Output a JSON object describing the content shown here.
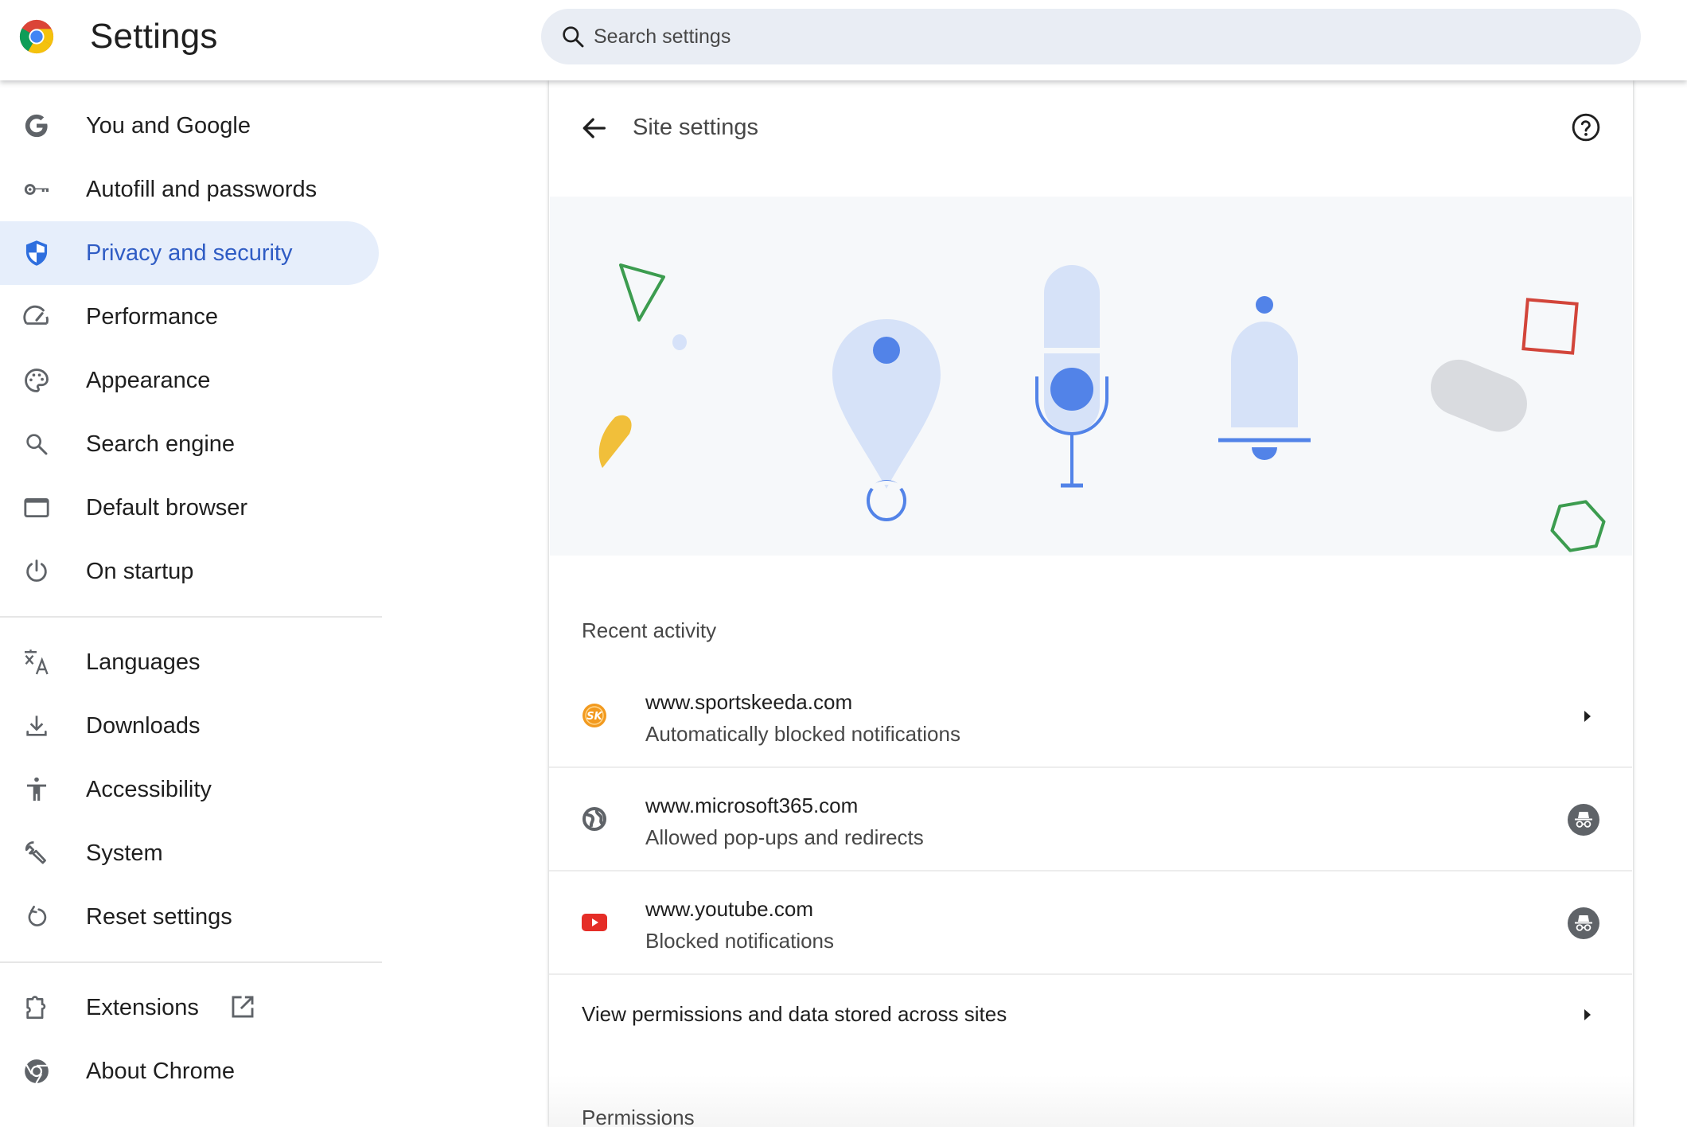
{
  "header": {
    "title": "Settings",
    "search_placeholder": "Search settings",
    "search_value": ""
  },
  "sidebar": {
    "items": [
      {
        "label": "You and Google",
        "icon": "google-g-icon",
        "selected": false
      },
      {
        "label": "Autofill and passwords",
        "icon": "key-icon",
        "selected": false
      },
      {
        "label": "Privacy and security",
        "icon": "shield-icon",
        "selected": true
      },
      {
        "label": "Performance",
        "icon": "speedometer-icon",
        "selected": false
      },
      {
        "label": "Appearance",
        "icon": "palette-icon",
        "selected": false
      },
      {
        "label": "Search engine",
        "icon": "search-icon",
        "selected": false
      },
      {
        "label": "Default browser",
        "icon": "browser-window-icon",
        "selected": false
      },
      {
        "label": "On startup",
        "icon": "power-icon",
        "selected": false
      },
      {
        "label": "Languages",
        "icon": "translate-icon",
        "selected": false
      },
      {
        "label": "Downloads",
        "icon": "download-icon",
        "selected": false
      },
      {
        "label": "Accessibility",
        "icon": "accessibility-icon",
        "selected": false
      },
      {
        "label": "System",
        "icon": "wrench-icon",
        "selected": false
      },
      {
        "label": "Reset settings",
        "icon": "reset-icon",
        "selected": false
      },
      {
        "label": "Extensions",
        "icon": "puzzle-icon",
        "selected": false,
        "external": true
      },
      {
        "label": "About Chrome",
        "icon": "chrome-icon",
        "selected": false
      }
    ]
  },
  "main": {
    "title": "Site settings",
    "back_label": "Back",
    "help_label": "Help",
    "recent_activity": {
      "heading": "Recent activity",
      "rows": [
        {
          "site": "www.sportskeeda.com",
          "action": "Automatically blocked notifications",
          "favicon": "sportskeeda-favicon",
          "trailing": "arrow"
        },
        {
          "site": "www.microsoft365.com",
          "action": "Allowed pop-ups and redirects",
          "favicon": "globe-icon",
          "trailing": "incognito"
        },
        {
          "site": "www.youtube.com",
          "action": "Blocked notifications",
          "favicon": "youtube-favicon",
          "trailing": "incognito"
        }
      ]
    },
    "view_all_label": "View permissions and data stored across sites",
    "permissions_heading": "Permissions"
  },
  "colors": {
    "accent": "#2f5cc4",
    "selected_bg": "#e6eefb",
    "search_bg": "#e9edf4",
    "illustration_bg": "#f6f8fa",
    "youtube_red": "#e52d27",
    "sportskeeda_orange": "#f29a1f"
  }
}
